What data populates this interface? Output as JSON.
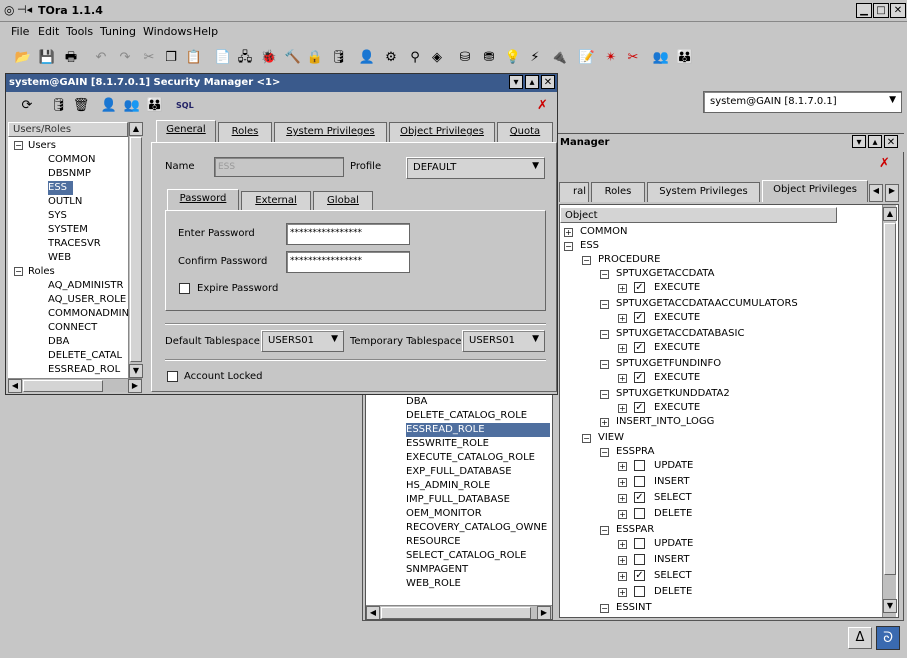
{
  "app": {
    "title": "TOra 1.1.4"
  },
  "menu": [
    "File",
    "Edit",
    "Tools",
    "Tuning",
    "Windows",
    "Help"
  ],
  "connection": {
    "value": "system@GAIN [8.1.7.0.1]"
  },
  "security_window": {
    "title": "system@GAIN [8.1.7.0.1] Security Manager <1>",
    "sql_icon": "SQL",
    "left_header": "Users/Roles",
    "tree": {
      "users_label": "Users",
      "users": [
        "COMMON",
        "DBSNMP",
        "ESS",
        "OUTLN",
        "SYS",
        "SYSTEM",
        "TRACESVR",
        "WEB"
      ],
      "roles_label": "Roles",
      "roles": [
        "AQ_ADMINISTR",
        "AQ_USER_ROLE",
        "COMMONADMIN",
        "CONNECT",
        "DBA",
        "DELETE_CATAL",
        "ESSREAD_ROL"
      ]
    },
    "tabs": [
      "General",
      "Roles",
      "System Privileges",
      "Object Privileges",
      "Quota"
    ],
    "general": {
      "name_label": "Name",
      "name_value": "ESS",
      "profile_label": "Profile",
      "profile_value": "DEFAULT",
      "auth_tabs": [
        "Password",
        "External",
        "Global"
      ],
      "enter_password_label": "Enter Password",
      "enter_password_value": "****************",
      "confirm_password_label": "Confirm Password",
      "confirm_password_value": "****************",
      "expire_label": "Expire Password",
      "default_ts_label": "Default Tablespace",
      "default_ts_value": "USERS01",
      "temp_ts_label": "Temporary Tablespace",
      "temp_ts_value": "USERS01",
      "locked_label": "Account Locked"
    }
  },
  "back_window": {
    "title": "Manager",
    "tabs": [
      "ral",
      "Roles",
      "System Privileges",
      "Object Privileges"
    ],
    "roles_list": [
      "DBA",
      "DELETE_CATALOG_ROLE",
      "ESSREAD_ROLE",
      "ESSWRITE_ROLE",
      "EXECUTE_CATALOG_ROLE",
      "EXP_FULL_DATABASE",
      "HS_ADMIN_ROLE",
      "IMP_FULL_DATABASE",
      "OEM_MONITOR",
      "RECOVERY_CATALOG_OWNE",
      "RESOURCE",
      "SELECT_CATALOG_ROLE",
      "SNMPAGENT",
      "WEB_ROLE"
    ],
    "object_header": "Object",
    "objects": [
      {
        "t": "COMMON"
      },
      {
        "t": "ESS"
      },
      {
        "t": "PROCEDURE"
      },
      {
        "t": "SPTUXGETACCDATA"
      },
      {
        "t": "EXECUTE"
      },
      {
        "t": "SPTUXGETACCDATAACCUMULATORS"
      },
      {
        "t": "EXECUTE"
      },
      {
        "t": "SPTUXGETACCDATABASIC"
      },
      {
        "t": "EXECUTE"
      },
      {
        "t": "SPTUXGETFUNDINFO"
      },
      {
        "t": "EXECUTE"
      },
      {
        "t": "SPTUXGETKUNDDATA2"
      },
      {
        "t": "EXECUTE"
      },
      {
        "t": "INSERT_INTO_LOGG"
      },
      {
        "t": "VIEW"
      },
      {
        "t": "ESSPRA"
      },
      {
        "t": "UPDATE"
      },
      {
        "t": "INSERT"
      },
      {
        "t": "SELECT"
      },
      {
        "t": "DELETE"
      },
      {
        "t": "ESSPAR"
      },
      {
        "t": "UPDATE"
      },
      {
        "t": "INSERT"
      },
      {
        "t": "SELECT"
      },
      {
        "t": "DELETE"
      },
      {
        "t": "ESSINT"
      }
    ]
  },
  "status": {
    "delta_icon": "Δ"
  }
}
